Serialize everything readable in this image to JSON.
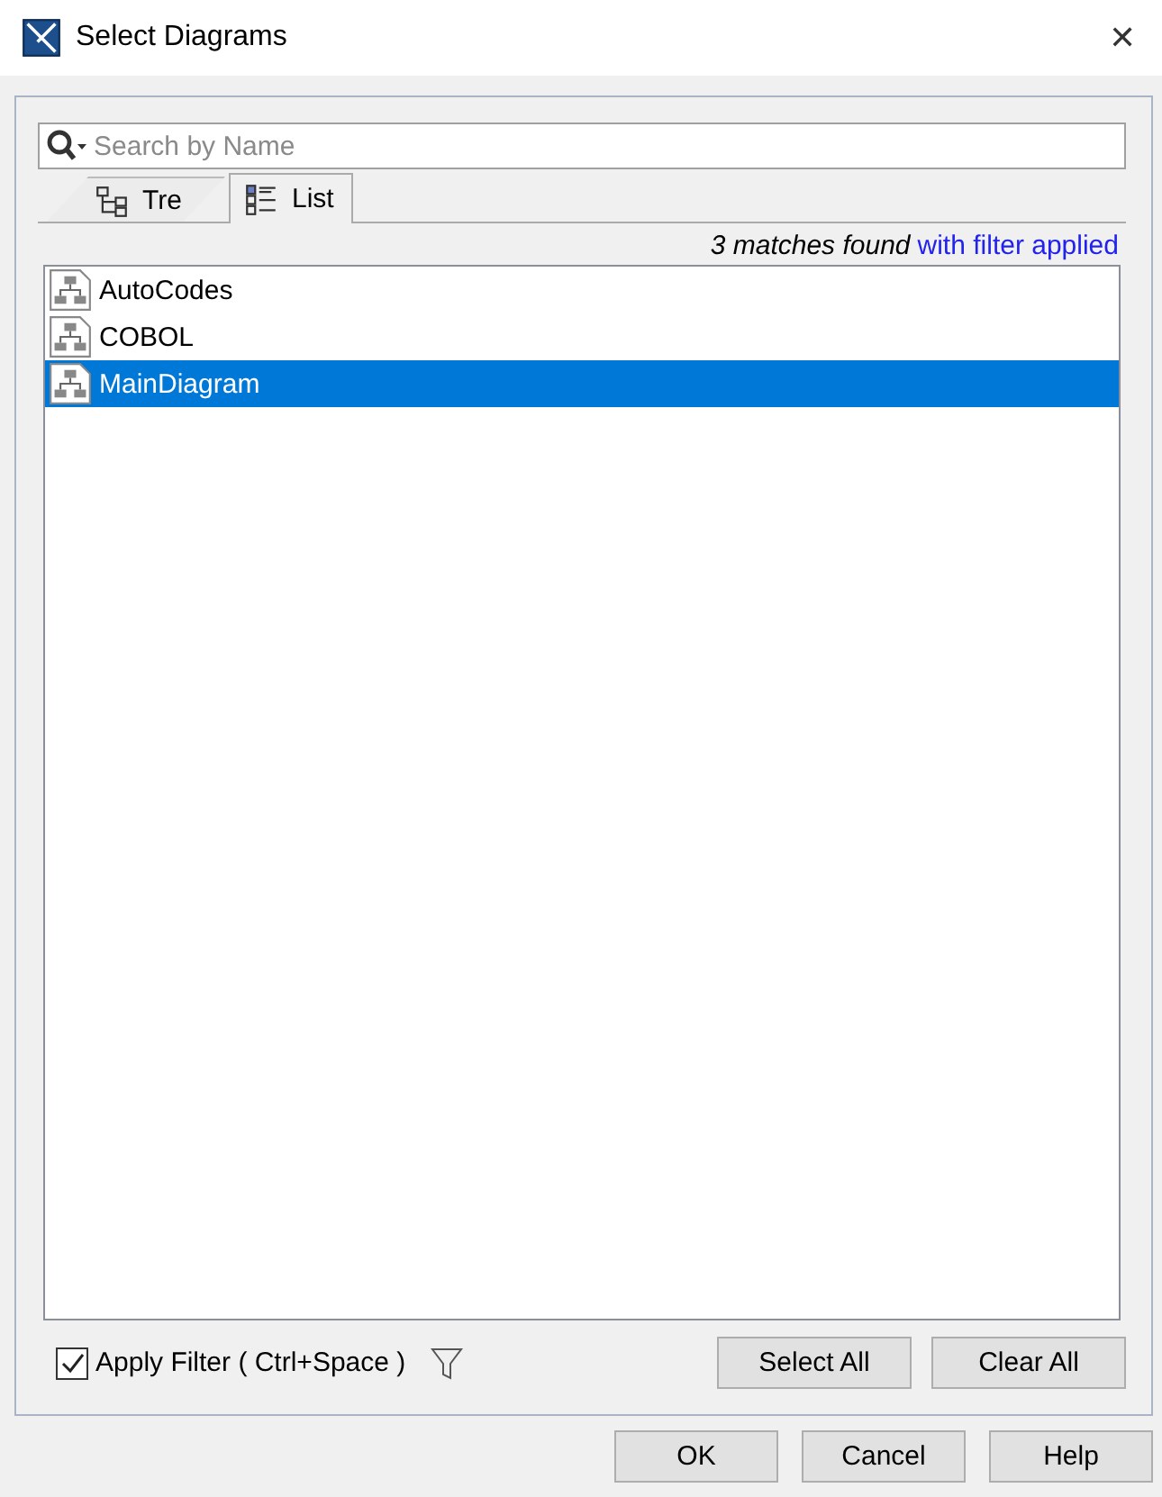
{
  "window": {
    "title": "Select Diagrams",
    "close": "✕"
  },
  "search": {
    "placeholder": "Search by Name"
  },
  "tabs": [
    {
      "label": "Tre",
      "kind": "tree",
      "selected": false
    },
    {
      "label": "List",
      "kind": "list",
      "selected": true
    }
  ],
  "status": {
    "count": "3 matches found",
    "filter_note": "with filter applied"
  },
  "items": [
    {
      "label": "AutoCodes",
      "selected": false
    },
    {
      "label": "COBOL",
      "selected": false
    },
    {
      "label": "MainDiagram",
      "selected": true
    }
  ],
  "apply_filter": {
    "label": "Apply Filter ( Ctrl+Space )",
    "checked": true
  },
  "list_buttons": [
    "Select All",
    "Clear All"
  ],
  "buttons": [
    "OK",
    "Cancel",
    "Help"
  ]
}
